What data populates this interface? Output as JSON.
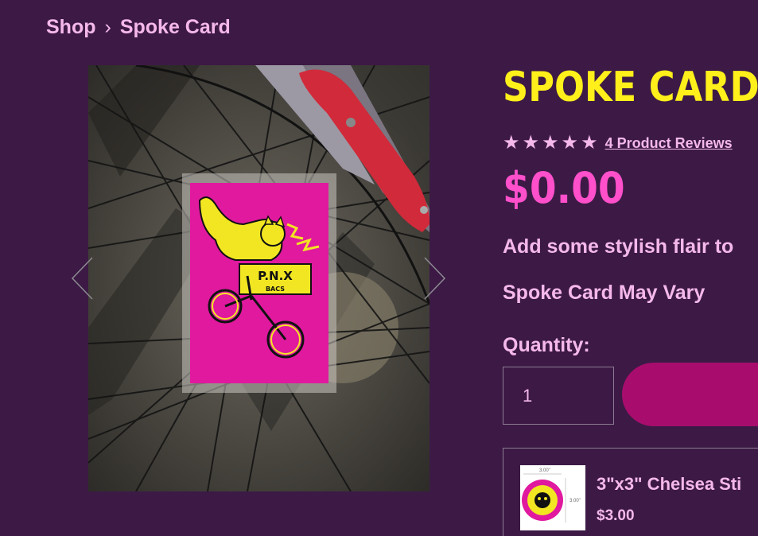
{
  "breadcrumb": {
    "shop": "Shop",
    "separator": "›",
    "current": "Spoke Card"
  },
  "product": {
    "title": "SPOKE CARD",
    "rating": 5,
    "stars": [
      "★",
      "★",
      "★",
      "★",
      "★"
    ],
    "reviews_link": "4 Product Reviews",
    "price": "$0.00",
    "description": "Add some stylish flair to",
    "note": "Spoke Card May Vary",
    "quantity_label": "Quantity:",
    "quantity_value": "1"
  },
  "image": {
    "card_text_1": "P.N.X",
    "card_text_2": "BACS"
  },
  "upsell": {
    "name": "3\"x3\" Chelsea Sti",
    "price": "$3.00",
    "thumb_dim_top": "3.00\"",
    "thumb_dim_side": "3.00\""
  },
  "colors": {
    "background": "#3c1a45",
    "title": "#ffef1a",
    "price": "#ff4fcb",
    "text": "#f5b8ea",
    "button": "#a80d6d",
    "card": "#e0199f"
  }
}
